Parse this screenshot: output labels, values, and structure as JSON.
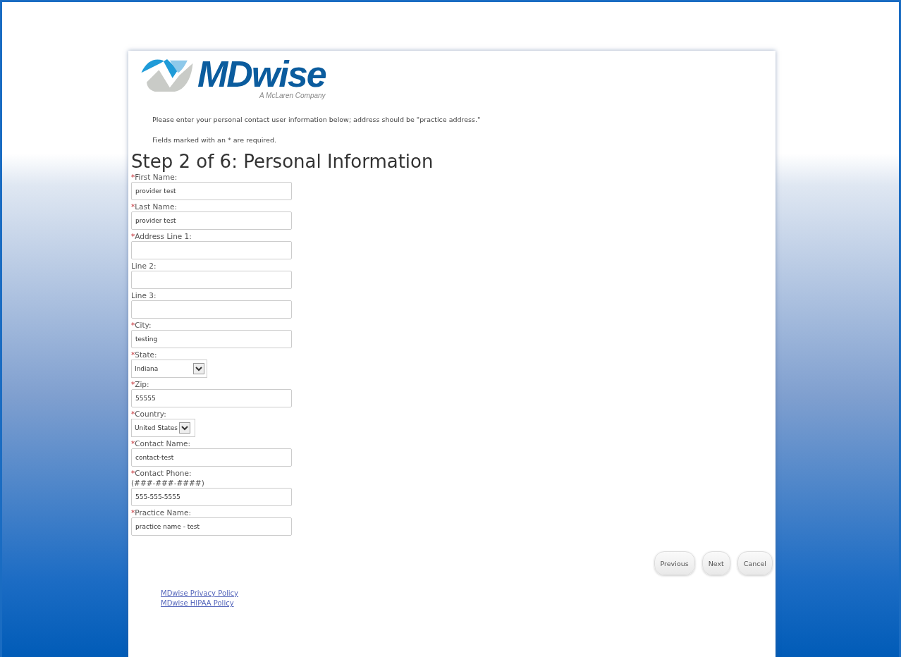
{
  "logo": {
    "name": "MDwise",
    "tagline": "A McLaren Company"
  },
  "intro": [
    "Please enter your personal contact user information below; address should be \"practice address.\"",
    "Fields marked with an * are required."
  ],
  "heading": "Step 2 of 6: Personal Information",
  "fields": [
    {
      "kind": "text",
      "mark": "*",
      "label": "First Name:",
      "value": "provider test"
    },
    {
      "kind": "text",
      "mark": "*",
      "label": "Last Name:",
      "value": "provider test"
    },
    {
      "kind": "text",
      "mark": "*",
      "label": "Address Line 1:"
    },
    {
      "kind": "text",
      "label": "Line 2:"
    },
    {
      "kind": "text",
      "label": "Line 3:"
    },
    {
      "kind": "text",
      "mark": "*",
      "label": "City:",
      "value": "testing"
    },
    {
      "kind": "select",
      "mark": "*",
      "label": "State:",
      "value": "Indiana"
    },
    {
      "kind": "text",
      "mark": "*",
      "label": "Zip:",
      "value": "55555"
    },
    {
      "kind": "select",
      "mark": "*",
      "label": "Country:",
      "value": "United States"
    },
    {
      "kind": "text",
      "mark": "*",
      "label": "Contact Name:",
      "value": "contact-test"
    },
    {
      "kind": "text",
      "mark": "*",
      "label": "Contact Phone:",
      "hint": "(###-###-####)",
      "value": "555-555-5555"
    },
    {
      "kind": "text",
      "mark": "*",
      "label": "Practice Name:",
      "value": "practice name - test"
    }
  ],
  "buttons": [
    "Previous",
    "Next",
    "Cancel"
  ],
  "links": [
    "MDwise Privacy Policy",
    "MDwise HIPAA Policy"
  ]
}
